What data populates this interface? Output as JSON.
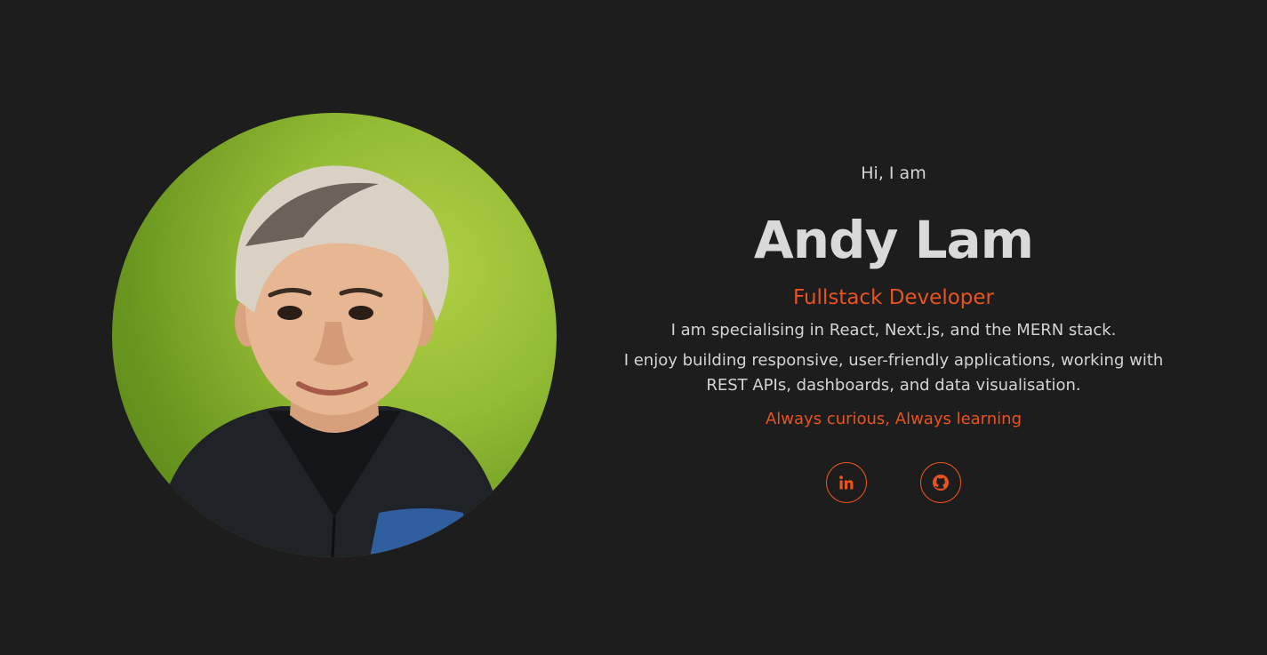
{
  "hero": {
    "greeting": "Hi, I am",
    "name": "Andy Lam",
    "role": "Fullstack Developer",
    "bio_line_1": "I am specialising in React, Next.js, and the MERN stack.",
    "bio_line_2": "I enjoy building responsive, user-friendly applications, working with REST APIs, dashboards, and data visualisation.",
    "tagline": "Always curious, Always learning"
  },
  "socials": [
    {
      "icon": "linkedin-icon"
    },
    {
      "icon": "github-icon"
    }
  ],
  "colors": {
    "background": "#1d1d1d",
    "accent": "#e8531f",
    "text": "#d6d6d6",
    "avatar_background": "#94bc35"
  }
}
